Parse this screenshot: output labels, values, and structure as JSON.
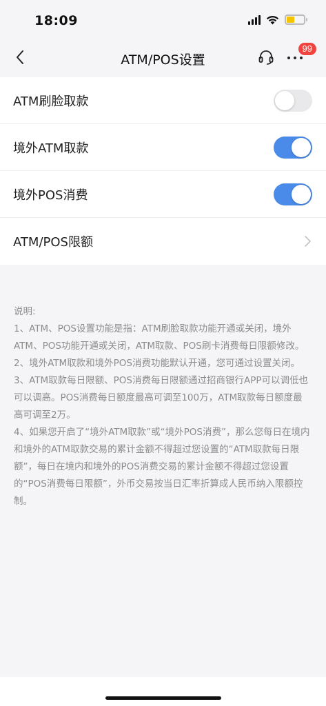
{
  "status_bar": {
    "time": "18:09"
  },
  "nav": {
    "title": "ATM/POS设置",
    "badge": "99"
  },
  "settings": [
    {
      "label": "ATM刷脸取款",
      "type": "toggle",
      "on": false
    },
    {
      "label": "境外ATM取款",
      "type": "toggle",
      "on": true
    },
    {
      "label": "境外POS消费",
      "type": "toggle",
      "on": true
    },
    {
      "label": "ATM/POS限额",
      "type": "link"
    }
  ],
  "notes": {
    "heading": "说明:",
    "items": [
      "1、ATM、POS设置功能是指：ATM刷脸取款功能开通或关闭，境外ATM、POS功能开通或关闭，ATM取款、POS刷卡消费每日限额修改。",
      "2、境外ATM取款和境外POS消费功能默认开通，您可通过设置关闭。",
      "3、ATM取款每日限额、POS消费每日限额通过招商银行APP可以调低也可以调高。POS消费每日额度最高可调至100万，ATM取款每日额度最高可调至2万。",
      "4、如果您开启了“境外ATM取款”或“境外POS消费”，那么您每日在境内和境外的ATM取款交易的累计金额不得超过您设置的“ATM取款每日限额”，每日在境内和境外的POS消费交易的累计金额不得超过您设置的“POS消费每日限额”，外币交易按当日汇率折算成人民币纳入限额控制。"
    ]
  },
  "colors": {
    "toggle_on": "#4a8ae8",
    "toggle_off": "#e9e9eb",
    "badge": "#f0453f",
    "battery": "#f5c400"
  },
  "icons": {
    "back": "chevron-left-icon",
    "support": "headset-icon",
    "more": "more-dots-icon",
    "link": "chevron-right-icon"
  }
}
